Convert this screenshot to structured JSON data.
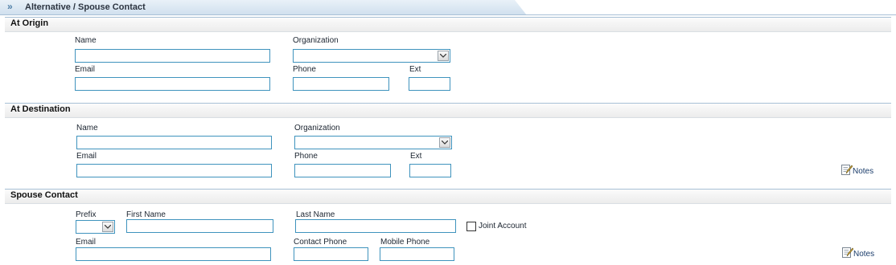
{
  "title_bar": {
    "chevron": "»",
    "title": "Alternative / Spouse Contact"
  },
  "origin": {
    "header": "At Origin",
    "name_label": "Name",
    "organization_label": "Organization",
    "email_label": "Email",
    "phone_label": "Phone",
    "ext_label": "Ext",
    "name_value": "",
    "organization_value": "",
    "email_value": "",
    "phone_value": "",
    "ext_value": ""
  },
  "destination": {
    "header": "At Destination",
    "name_label": "Name",
    "organization_label": "Organization",
    "email_label": "Email",
    "phone_label": "Phone",
    "ext_label": "Ext",
    "notes_label": "Notes",
    "name_value": "",
    "organization_value": "",
    "email_value": "",
    "phone_value": "",
    "ext_value": ""
  },
  "spouse": {
    "header": "Spouse Contact",
    "prefix_label": "Prefix",
    "first_name_label": "First Name",
    "last_name_label": "Last Name",
    "joint_account_label": "Joint Account",
    "email_label": "Email",
    "contact_phone_label": "Contact Phone",
    "mobile_phone_label": "Mobile Phone",
    "notes_label": "Notes",
    "prefix_value": "",
    "first_name_value": "",
    "last_name_value": "",
    "email_value": "",
    "contact_phone_value": "",
    "mobile_phone_value": "",
    "joint_account_checked": false
  },
  "colors": {
    "field_border": "#3f93bd",
    "title_bar_bg": "#dbe7f2",
    "section_rule": "#a8c0d6"
  },
  "icons": {
    "title_chevron": "double-chevron-right-icon",
    "notes": "notes-pencil-icon",
    "dropdown": "chevron-down-icon"
  }
}
